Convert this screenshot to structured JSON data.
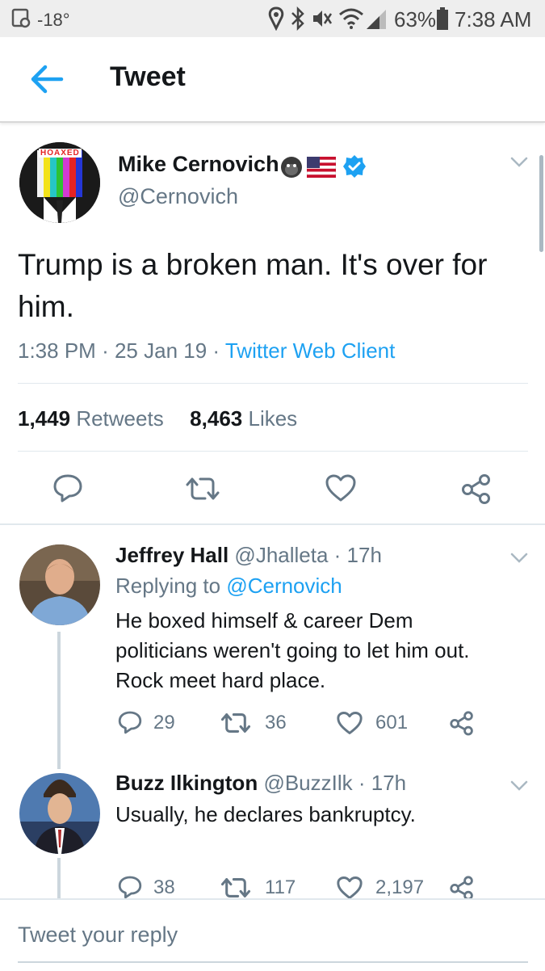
{
  "status_bar": {
    "temperature": "-18°",
    "battery_percent": "63%",
    "time": "7:38 AM"
  },
  "header": {
    "title": "Tweet"
  },
  "main_tweet": {
    "author_name": "Mike Cernovich",
    "author_handle": "@Cernovich",
    "avatar_text": "HOAXED",
    "text": "Trump is a broken man. It's over for him.",
    "time": "1:38 PM",
    "date": "25 Jan 19",
    "client": "Twitter Web Client",
    "retweets_count": "1,449",
    "retweets_label": "Retweets",
    "likes_count": "8,463",
    "likes_label": "Likes"
  },
  "replies": [
    {
      "author_name": "Jeffrey Hall",
      "author_handle": "@Jhalleta",
      "age": "17h",
      "replying_prefix": "Replying to",
      "replying_to": "@Cernovich",
      "text_lines": [
        "He boxed himself & career Dem",
        "politicians weren't going to let him out.",
        "Rock meet hard place."
      ],
      "replies": "29",
      "retweets": "36",
      "likes": "601"
    },
    {
      "author_name": "Buzz Ilkington",
      "author_handle": "@BuzzIlk",
      "age": "17h",
      "text_lines": [
        "Usually, he declares bankruptcy."
      ],
      "replies": "38",
      "retweets": "117",
      "likes": "2,197"
    }
  ],
  "composer": {
    "placeholder": "Tweet your reply"
  },
  "colors": {
    "accent": "#1da1f2",
    "text_secondary": "#657786",
    "verified": "#1da1f2"
  }
}
